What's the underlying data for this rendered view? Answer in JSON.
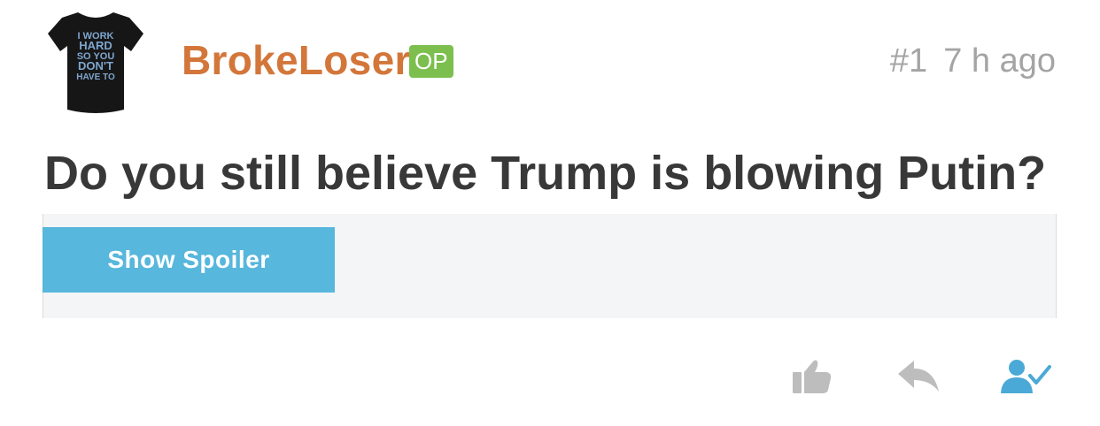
{
  "post": {
    "author": "BrokeLoser",
    "author_badge": "OP",
    "post_number": "#1",
    "time_ago": "7 h ago",
    "title": "Do you still believe Trump is blowing Putin?",
    "spoiler_label": "Show Spoiler"
  },
  "avatar": {
    "icon": "tshirt-avatar",
    "shirt_lines": [
      "I WORK",
      "HARD",
      "SO YOU",
      "DON'T",
      "HAVE TO"
    ]
  },
  "actions": {
    "icons": [
      "thumbs-up-icon",
      "reply-icon",
      "follow-user-icon"
    ]
  },
  "colors": {
    "author": "#d3763a",
    "badge": "#7cbf4e",
    "spoiler_button": "#57b7dc",
    "follow_icon": "#4aa9d6",
    "muted_icon": "#bdbdbd"
  }
}
